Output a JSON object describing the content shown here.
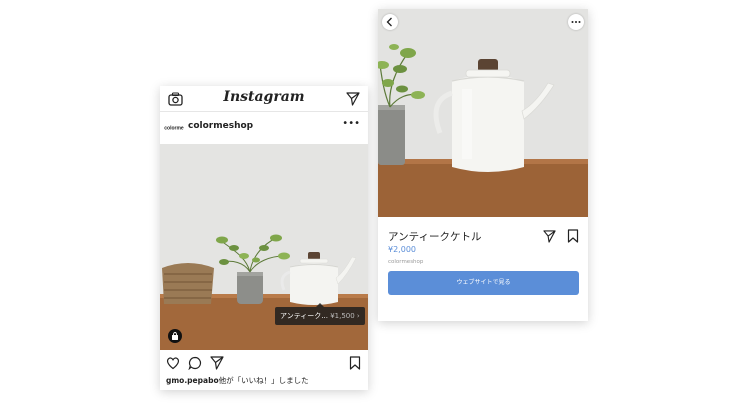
{
  "feed": {
    "app_name": "Instagram",
    "username": "colormeshop",
    "avatar_text": "colorme",
    "tag": {
      "name": "アンティーク...",
      "price": "¥1,500 ›"
    },
    "likes": {
      "user": "gmo.pepabo",
      "text": "他が「いいね！」しました"
    }
  },
  "product": {
    "name": "アンティークケトル",
    "price": "¥2,000",
    "shop": "colormeshop",
    "web_button": "ウェブサイトで見る"
  },
  "colors": {
    "accent": "#5b8ed8",
    "tag_bg": "#1e1e1e"
  }
}
